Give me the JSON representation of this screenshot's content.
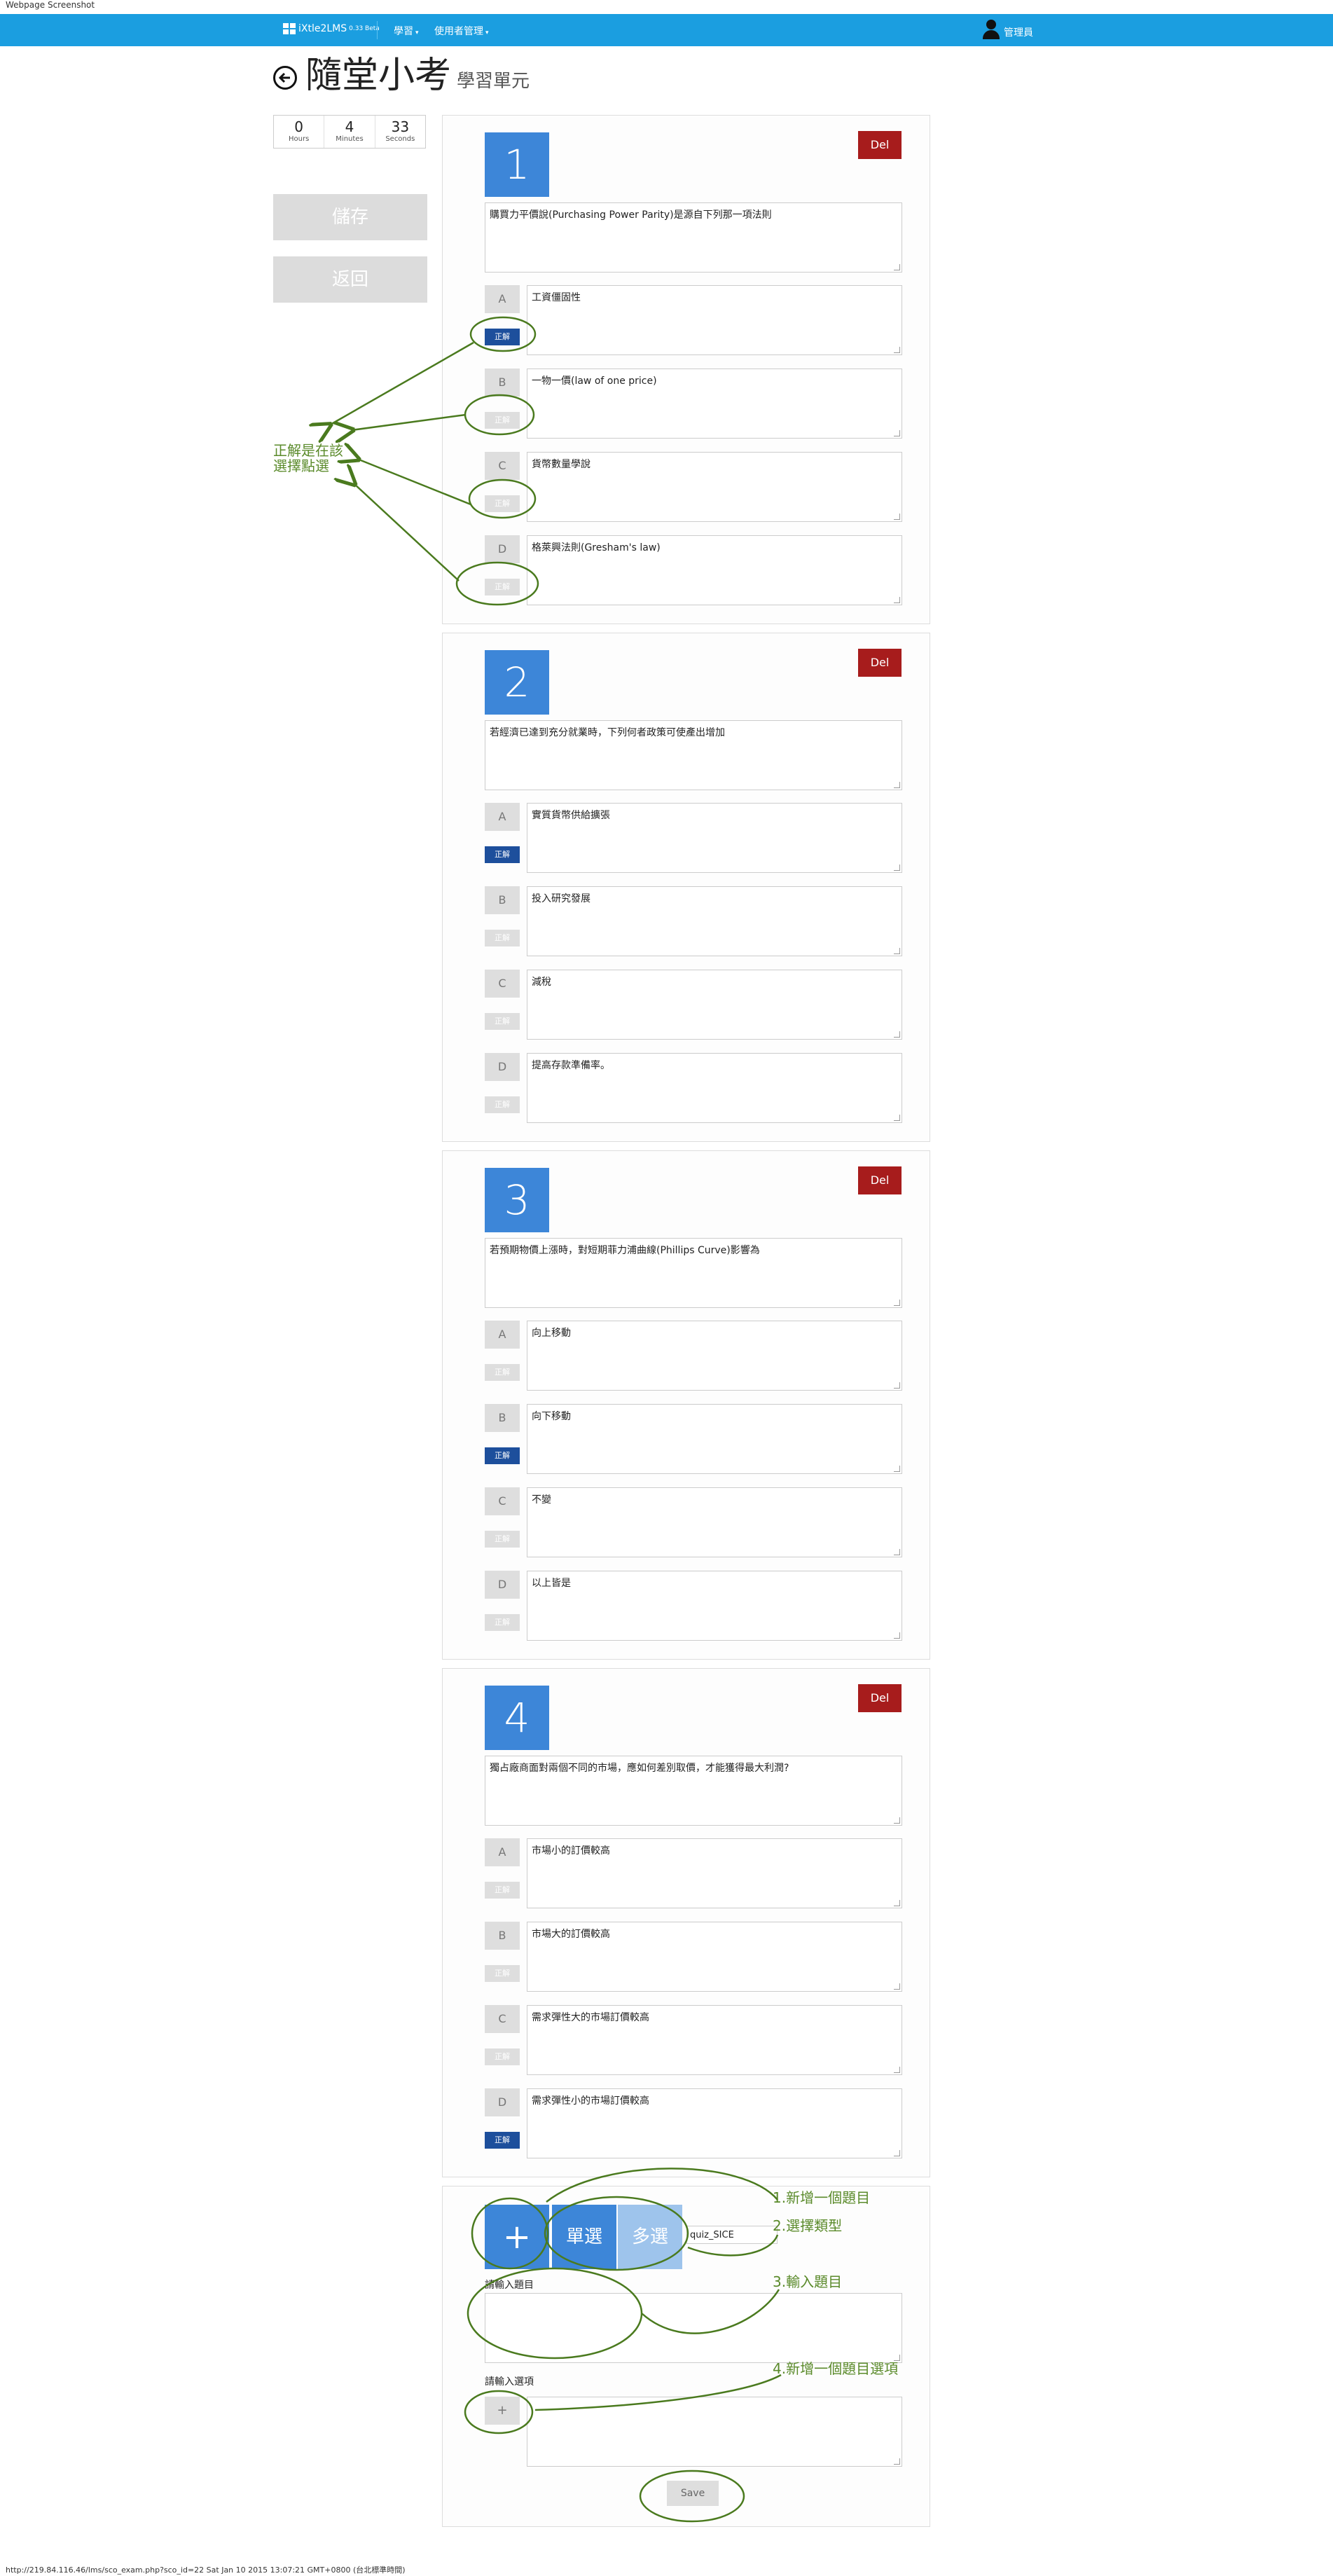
{
  "capture_label": "Webpage Screenshot",
  "navbar": {
    "brand": "iXtle2LMS",
    "version": "0.33 Beta",
    "menu": [
      {
        "label": "學習"
      },
      {
        "label": "使用者管理"
      }
    ],
    "user": "管理員"
  },
  "header": {
    "title": "隨堂小考",
    "subtitle": "學習單元"
  },
  "timer": {
    "hours": "0",
    "hours_label": "Hours",
    "minutes": "4",
    "minutes_label": "Minutes",
    "seconds": "33",
    "seconds_label": "Seconds"
  },
  "sidebar": {
    "save_label": "儲存",
    "back_label": "返回"
  },
  "labels": {
    "delete": "Del",
    "correct": "正解"
  },
  "questions": [
    {
      "number": "1",
      "text": "購買力平價說(Purchasing Power Parity)是源自下列那一項法則",
      "options": [
        {
          "letter": "A",
          "text": "工資僵固性",
          "correct": true
        },
        {
          "letter": "B",
          "text": "一物一價(law of one price)",
          "correct": false
        },
        {
          "letter": "C",
          "text": "貨幣數量學說",
          "correct": false
        },
        {
          "letter": "D",
          "text": "格萊興法則(Gresham's law)",
          "correct": false
        }
      ]
    },
    {
      "number": "2",
      "text": "若經濟已達到充分就業時，下列何者政策可使產出增加",
      "options": [
        {
          "letter": "A",
          "text": "實質貨幣供給擴張",
          "correct": true
        },
        {
          "letter": "B",
          "text": "投入研究發展",
          "correct": false
        },
        {
          "letter": "C",
          "text": "減稅",
          "correct": false
        },
        {
          "letter": "D",
          "text": "提高存款準備率。",
          "correct": false
        }
      ]
    },
    {
      "number": "3",
      "text": "若預期物價上漲時，對短期菲力浦曲線(Phillips Curve)影響為",
      "options": [
        {
          "letter": "A",
          "text": "向上移動",
          "correct": false
        },
        {
          "letter": "B",
          "text": "向下移動",
          "correct": true
        },
        {
          "letter": "C",
          "text": "不變",
          "correct": false
        },
        {
          "letter": "D",
          "text": "以上皆是",
          "correct": false
        }
      ]
    },
    {
      "number": "4",
      "text": "獨占廠商面對兩個不同的市場，應如何差別取價，才能獲得最大利潤?",
      "options": [
        {
          "letter": "A",
          "text": "市場小的訂價較高",
          "correct": false
        },
        {
          "letter": "B",
          "text": "市場大的訂價較高",
          "correct": false
        },
        {
          "letter": "C",
          "text": "需求彈性大的市場訂價較高",
          "correct": false
        },
        {
          "letter": "D",
          "text": "需求彈性小的市場訂價較高",
          "correct": true
        }
      ]
    }
  ],
  "new_question": {
    "add_label": "+",
    "single_label": "單選",
    "multi_label": "多選",
    "quiz_value": "quiz_SICE",
    "question_prompt": "請輸入題目",
    "option_prompt": "請輸入選項",
    "add_option_label": "+",
    "save_label": "Save"
  },
  "annotations": {
    "correct_note_line1": "正解是在該",
    "correct_note_line2": "選擇點選",
    "step1": "1.新增一個題目",
    "step2": "2.選擇類型",
    "step3": "3.輸入題目",
    "step4": "4.新增一個題目選項",
    "color": "#5a8a2a"
  },
  "status_url": "http://219.84.116.46/lms/sco_exam.php?sco_id=22 Sat Jan 10 2015 13:07:21 GMT+0800 (台北標準時間)"
}
